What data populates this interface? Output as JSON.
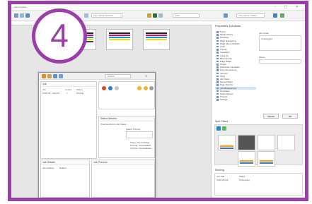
{
  "window": {
    "title": "Fiery Impose"
  },
  "badge": {
    "number": "4"
  },
  "toolbar": {
    "field1": "Fiery Server Network",
    "field2": "Letter",
    "field3": "Fiery Server Status"
  },
  "properties": {
    "title": "Properties & Actions",
    "tree": [
      "Fonts",
      "Media Library",
      "Finishing",
      "Page Numbering",
      "Page Size & Position",
      "Color",
      "Impose",
      "Imposition",
      "Gang Up",
      "Bleed & Trim",
      "Edge Marks",
      "Output",
      "Advanced Imposition",
      "Fiery Dimensions",
      "Job Info",
      "Tiling",
      "Job Notes",
      "Merge Pages",
      "Page Reorder",
      "Job Management",
      "Templates",
      "Scale Options",
      "Presets",
      "Settings"
    ],
    "selected_index": 19,
    "job_folder_label": "Job Folder",
    "job_folder_value": "Unassigned",
    "cancel_label": "Cancel",
    "ok_label": "OK",
    "dropdown_label": "Sheet"
  },
  "spot_colors": {
    "title": "Spot Colors"
  },
  "working": {
    "title": "Working",
    "col_job": "Job Title",
    "col_status": "Status",
    "status_value": "Processing",
    "row_name": "CWP-30.pdf"
  },
  "dialog": {
    "field": "Default",
    "list_title": "Job",
    "col1": "Job",
    "col2": "Copies",
    "col3": "Status",
    "row_name": "CWP-30_mail.pdf",
    "row_copies": "1",
    "row_status": "Printing",
    "footer": "Done   Ready   100%   Paused",
    "status_title": "Status Monitor",
    "status_tabs": "Overview   Errors   Job Status",
    "status_field": "Status:",
    "status_value": "Printing",
    "status_line1": "Paper: Not Available",
    "status_line2": "Printing: Not Available",
    "status_line3": "Finisher: Not Available",
    "details_title": "Job Details",
    "preview_title": "Job Preview",
    "details_tab": "Job Settings",
    "details_value": "Default"
  }
}
